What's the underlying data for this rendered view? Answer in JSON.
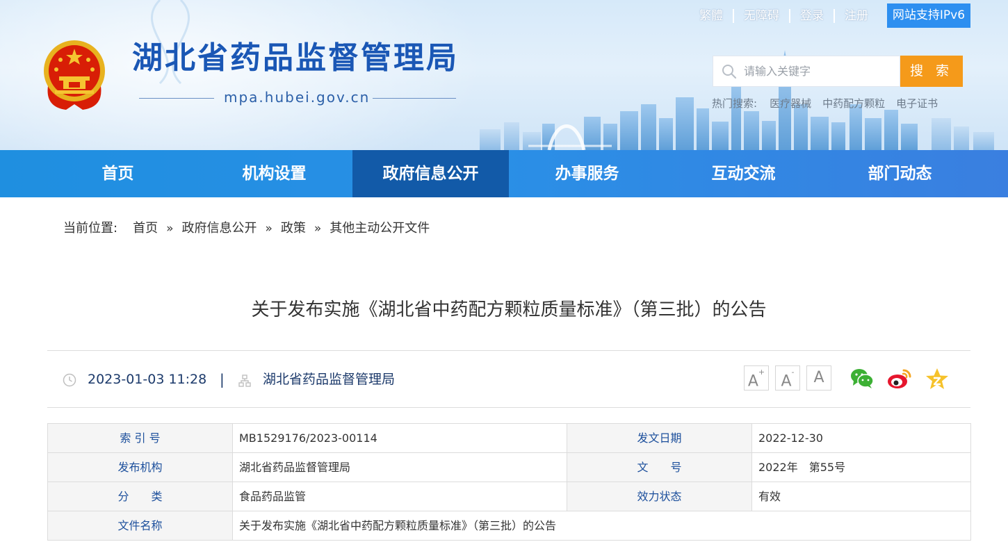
{
  "header": {
    "site_title": "湖北省药品监督管理局",
    "site_domain": "mpa.hubei.gov.cn",
    "top_links": [
      "繁體",
      "无障碍",
      "登录",
      "注册"
    ],
    "ipv6_badge": "网站支持IPv6",
    "search": {
      "placeholder": "请输入关键字",
      "button_label": "搜 索"
    },
    "hot_search": {
      "label": "热门搜索:",
      "items": [
        "医疗器械",
        "中药配方颗粒",
        "电子证书"
      ]
    }
  },
  "nav": {
    "items": [
      "首页",
      "机构设置",
      "政府信息公开",
      "办事服务",
      "互动交流",
      "部门动态"
    ],
    "active": "政府信息公开"
  },
  "breadcrumb": {
    "label": "当前位置:",
    "items": [
      "首页",
      "政府信息公开",
      "政策",
      "其他主动公开文件"
    ],
    "separator": "»"
  },
  "article": {
    "title": "关于发布实施《湖北省中药配方颗粒质量标准》（第三批）的公告",
    "date": "2023-01-03 11:28",
    "meta_separator": "|",
    "source": "湖北省药品监督管理局",
    "font_controls": [
      "A+",
      "A-",
      "A"
    ],
    "share_icons": [
      "wechat-icon",
      "weibo-icon",
      "favorite-star-icon"
    ]
  },
  "info_table": {
    "rows": [
      {
        "k1": "索 引 号",
        "v1": "MB1529176/2023-00114",
        "k2": "发文日期",
        "v2": "2022-12-30"
      },
      {
        "k1": "发布机构",
        "v1": "湖北省药品监督管理局",
        "k2": "文　　号",
        "v2": "2022年　第55号"
      },
      {
        "k1": "分　　类",
        "v1": "食品药品监管",
        "k2": "效力状态",
        "v2": "有效"
      }
    ],
    "file_name_label": "文件名称",
    "file_name_value": "关于发布实施《湖北省中药配方颗粒质量标准》（第三批）的公告"
  },
  "colors": {
    "nav_bg": "#2a8fe6",
    "nav_active": "#125aa8",
    "search_button": "#f59a1a",
    "title_blue": "#1a57b5",
    "ipv6_badge": "#2d8ff0"
  }
}
